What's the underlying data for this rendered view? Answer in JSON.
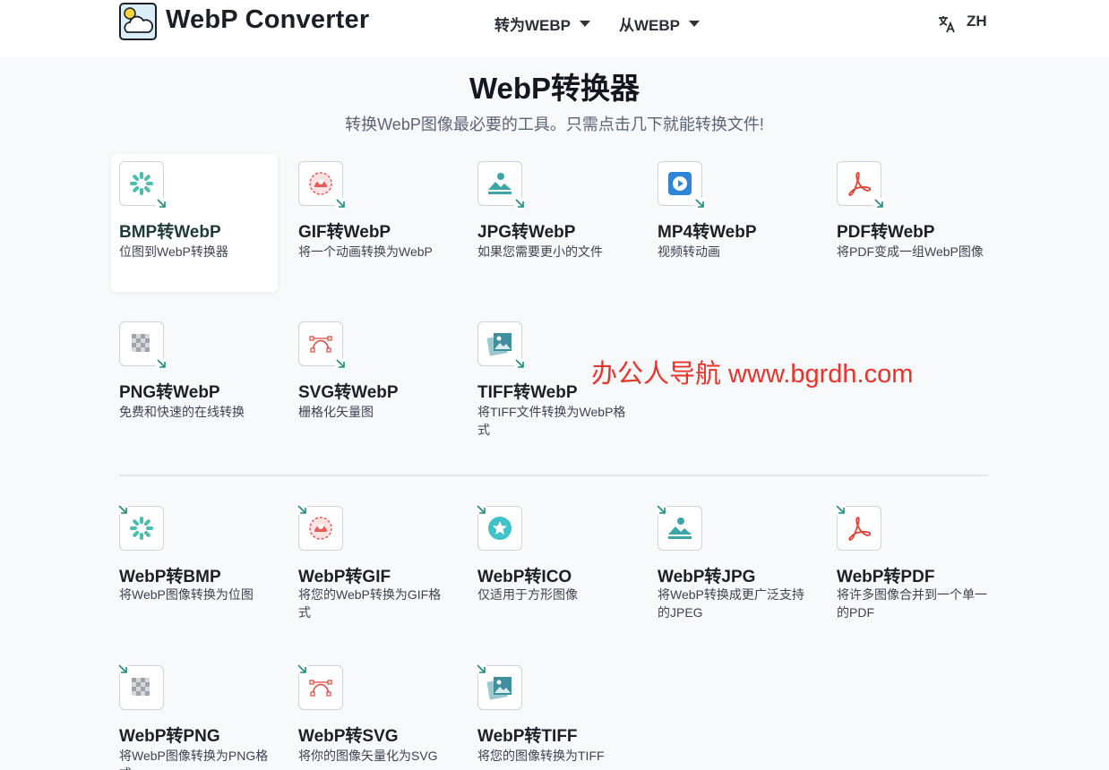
{
  "header": {
    "brand": "WebP Converter",
    "nav": [
      {
        "label": "转为WEBP"
      },
      {
        "label": "从WEBP"
      }
    ],
    "language": "ZH"
  },
  "main": {
    "title": "WebP转换器",
    "subtitle": "转换WebP图像最必要的工具。只需点击几下就能转换文件!"
  },
  "to_webp": [
    {
      "title": "BMP转WebP",
      "desc": "位图到WebP转换器",
      "icon": "bmp-icon"
    },
    {
      "title": "GIF转WebP",
      "desc": "将一个动画转换为WebP",
      "icon": "gif-icon"
    },
    {
      "title": "JPG转WebP",
      "desc": "如果您需要更小的文件",
      "icon": "jpg-icon"
    },
    {
      "title": "MP4转WebP",
      "desc": "视频转动画",
      "icon": "mp4-icon"
    },
    {
      "title": "PDF转WebP",
      "desc": "将PDF变成一组WebP图像",
      "icon": "pdf-icon"
    },
    {
      "title": "PNG转WebP",
      "desc": "免费和快速的在线转换",
      "icon": "png-icon"
    },
    {
      "title": "SVG转WebP",
      "desc": "栅格化矢量图",
      "icon": "svg-icon"
    },
    {
      "title": "TIFF转WebP",
      "desc": "将TIFF文件转换为WebP格式",
      "icon": "tiff-icon"
    }
  ],
  "from_webp": [
    {
      "title": "WebP转BMP",
      "desc": "将WebP图像转换为位图",
      "icon": "bmp-icon"
    },
    {
      "title": "WebP转GIF",
      "desc": "将您的WebP转换为GIF格式",
      "icon": "gif-icon"
    },
    {
      "title": "WebP转ICO",
      "desc": "仅适用于方形图像",
      "icon": "ico-icon"
    },
    {
      "title": "WebP转JPG",
      "desc": "将WebP转换成更广泛支持的JPEG",
      "icon": "jpg-icon"
    },
    {
      "title": "WebP转PDF",
      "desc": "将许多图像合并到一个单一的PDF",
      "icon": "pdf-icon"
    },
    {
      "title": "WebP转PNG",
      "desc": "将WebP图像转换为PNG格式",
      "icon": "png-icon"
    },
    {
      "title": "WebP转SVG",
      "desc": "将你的图像矢量化为SVG",
      "icon": "svg-icon"
    },
    {
      "title": "WebP转TIFF",
      "desc": "将您的图像转换为TIFF",
      "icon": "tiff-icon"
    }
  ],
  "watermark": "办公人导航  www.bgrdh.com",
  "colors": {
    "accent": "#1c8c7c",
    "watermark": "#e8342b",
    "pdf": "#e0453a"
  }
}
